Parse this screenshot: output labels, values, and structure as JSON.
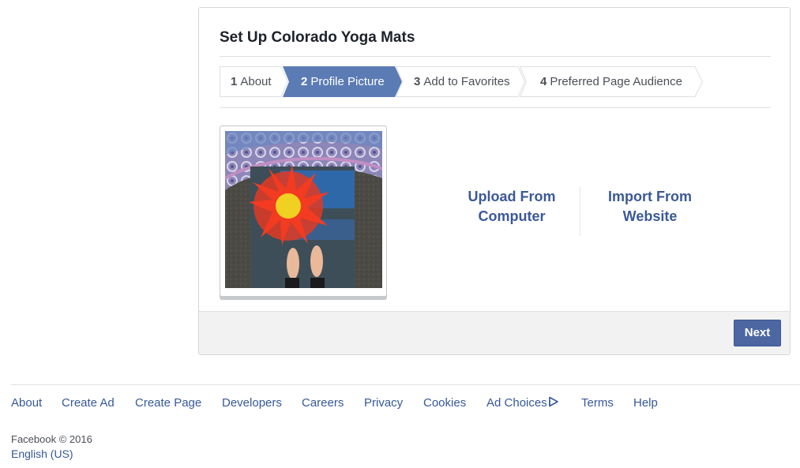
{
  "panel": {
    "title": "Set Up Colorado Yoga Mats",
    "steps": [
      {
        "number": "1",
        "label": "About",
        "active": false
      },
      {
        "number": "2",
        "label": "Profile Picture",
        "active": true
      },
      {
        "number": "3",
        "label": "Add to Favorites",
        "active": false
      },
      {
        "number": "4",
        "label": "Preferred Page Audience",
        "active": false
      }
    ],
    "upload_line1": "Upload From",
    "upload_line2": "Computer",
    "import_line1": "Import From",
    "import_line2": "Website",
    "next_label": "Next"
  },
  "footer": {
    "links": [
      "About",
      "Create Ad",
      "Create Page",
      "Developers",
      "Careers",
      "Privacy",
      "Cookies",
      "Ad Choices",
      "Terms",
      "Help"
    ],
    "copyright": "Facebook © 2016",
    "language": "English (US)"
  },
  "colors": {
    "accent": "#4c67a1",
    "link": "#365899",
    "active_step": "#5b7bb4"
  }
}
